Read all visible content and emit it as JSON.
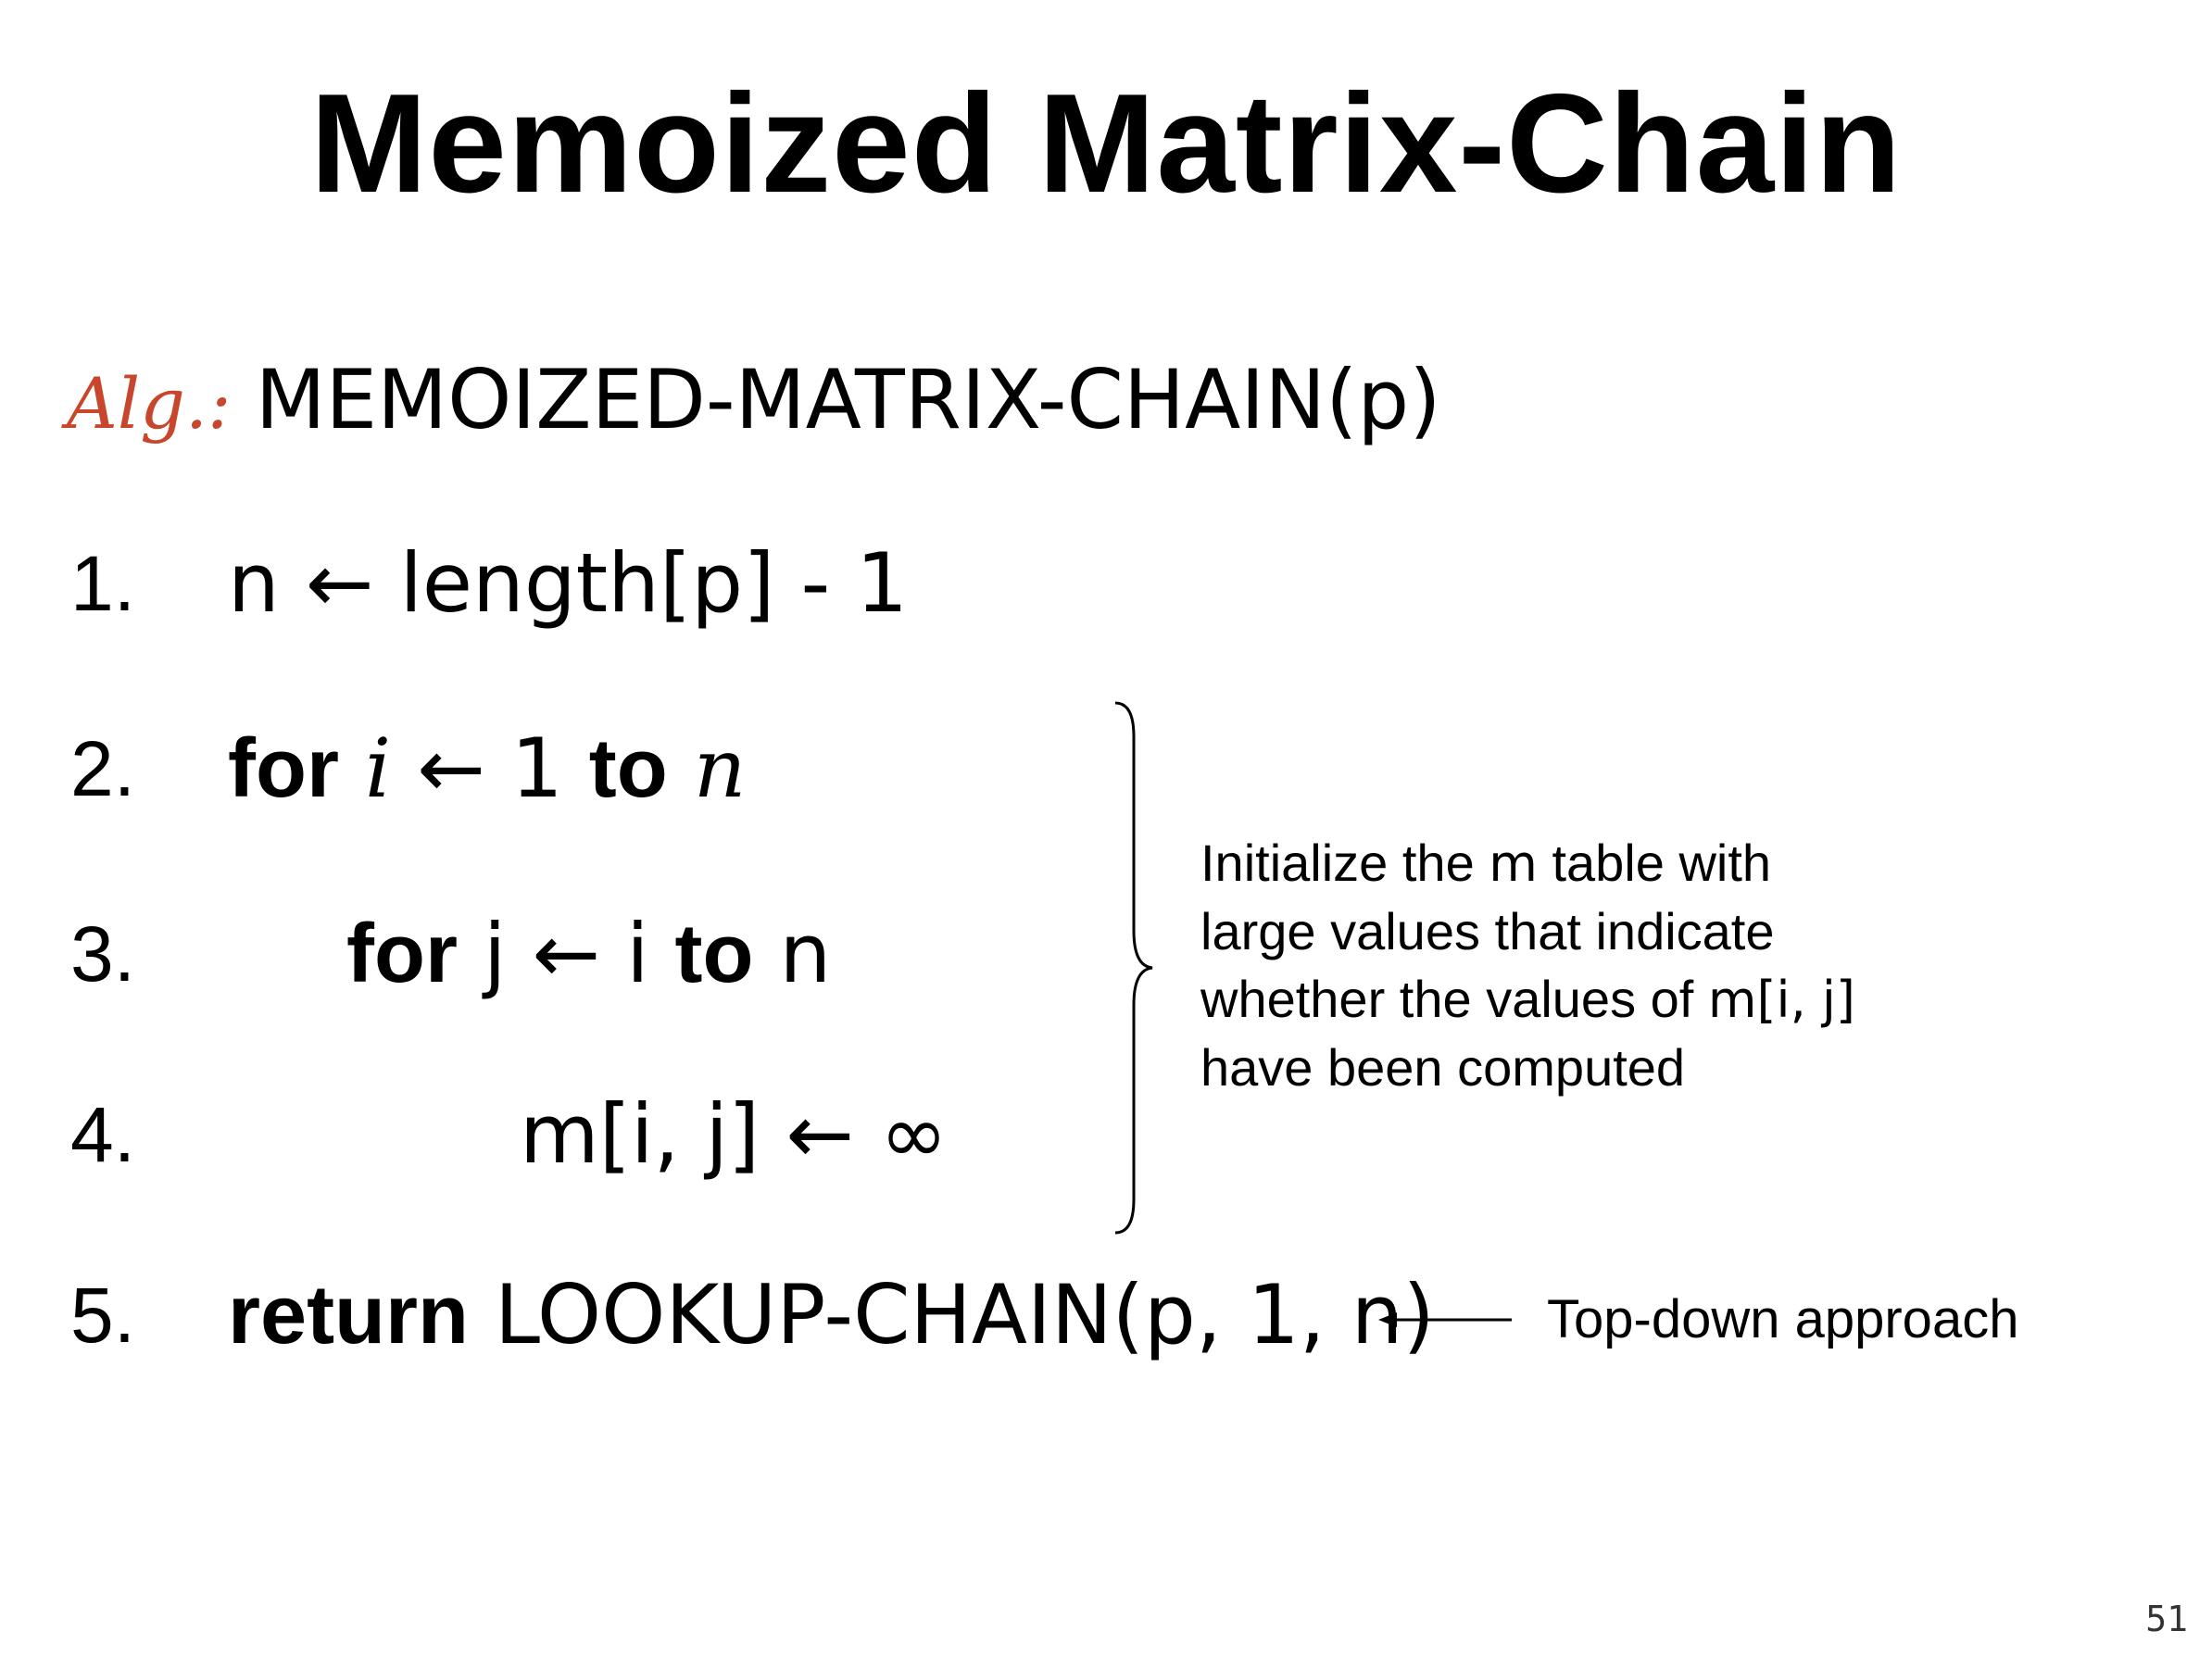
{
  "slide": {
    "title": "Memoized Matrix-Chain",
    "alg_label": "Alg.:",
    "alg_name": "MEMOIZED-MATRIX-CHAIN(p)",
    "page_number": "51"
  },
  "steps": [
    {
      "number": "1.",
      "code": "n ← length[p] - 1"
    },
    {
      "number": "2.",
      "kw1": "for",
      "var": "i",
      "assign": " ← 1 ",
      "kw2": "to",
      "end": "n"
    },
    {
      "number": "3.",
      "kw1": "for",
      "var": "j",
      "assign": " ← i ",
      "kw2": "to",
      "end": "n"
    },
    {
      "number": "4.",
      "code": "m[i, j] ← ∞"
    },
    {
      "number": "5.",
      "kw": "return",
      "code": "LOOKUP-CHAIN(p, 1, n)"
    }
  ],
  "annotations": {
    "init_note": {
      "line1_pre": "Initialize the ",
      "line1_m": "m",
      "line1_post": " table with",
      "line2": "large values that indicate",
      "line3_pre": "whether the values of ",
      "line3_m": "m[i, j]",
      "line4": "have been computed"
    },
    "topdown_label": "Top-down approach"
  }
}
